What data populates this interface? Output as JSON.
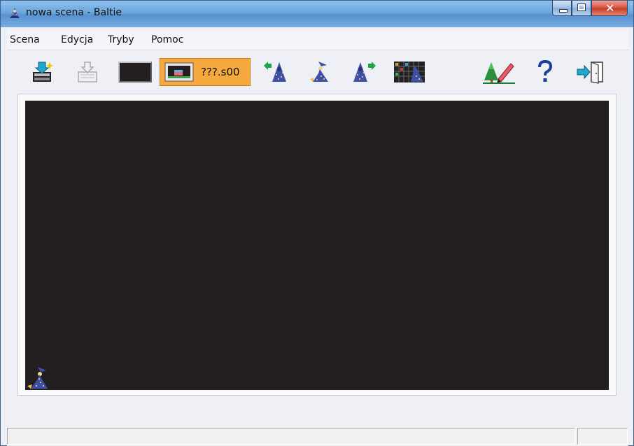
{
  "window": {
    "title": "nowa scena - Baltie",
    "title_icon": "wizard-icon",
    "controls": [
      "minimize-icon",
      "maximize-icon",
      "close-icon"
    ]
  },
  "menu": {
    "items": [
      {
        "label": "Scena"
      },
      {
        "label": "Edycja"
      },
      {
        "label": "Tryby"
      },
      {
        "label": "Pomoc"
      }
    ]
  },
  "toolbar": {
    "buttons": [
      {
        "icon": "open-scene-icon",
        "enabled": true
      },
      {
        "icon": "save-scene-icon",
        "enabled": false
      },
      {
        "icon": "black-screen-icon",
        "enabled": true
      },
      {
        "icon": "wizard-turn-left-icon",
        "enabled": true
      },
      {
        "icon": "wizard-step-icon",
        "enabled": true
      },
      {
        "icon": "wizard-turn-right-icon",
        "enabled": true
      },
      {
        "icon": "scene-grid-icon",
        "enabled": true
      },
      {
        "icon": "edit-scene-icon",
        "enabled": true
      },
      {
        "icon": "help-icon",
        "enabled": true
      },
      {
        "icon": "exit-icon",
        "enabled": true
      }
    ],
    "mode_button": {
      "label": "???.s00",
      "icon": "scene-thumbnail-icon",
      "accent_color": "#f5a93e"
    }
  },
  "scene": {
    "background_color": "#231f20",
    "sprite": "wizard-icon"
  },
  "status": {
    "left_text": "",
    "right_text": ""
  }
}
